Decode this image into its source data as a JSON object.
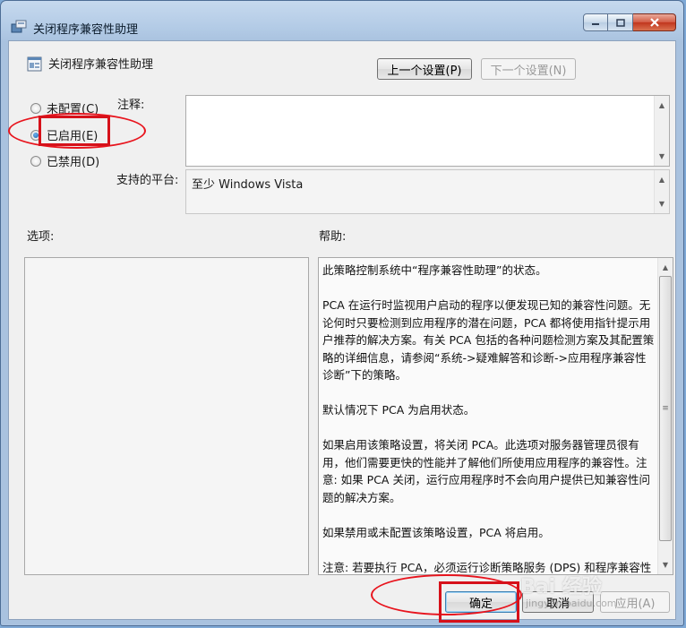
{
  "window": {
    "title": "关闭程序兼容性助理",
    "caption": {
      "minimize": "─",
      "maximize": "□",
      "close": "✕"
    }
  },
  "policy": {
    "name": "关闭程序兼容性助理",
    "prev_button": "上一个设置(P)",
    "next_button": "下一个设置(N)"
  },
  "state": {
    "options": [
      {
        "label": "未配置(C)",
        "checked": false
      },
      {
        "label": "已启用(E)",
        "checked": true
      },
      {
        "label": "已禁用(D)",
        "checked": false
      }
    ]
  },
  "comment": {
    "label": "注释:",
    "value": ""
  },
  "platform": {
    "label": "支持的平台:",
    "value": "至少 Windows Vista"
  },
  "options_section": {
    "label": "选项:"
  },
  "help_section": {
    "label": "帮助:",
    "paragraphs": [
      "此策略控制系统中“程序兼容性助理”的状态。",
      "PCA 在运行时监视用户启动的程序以便发现已知的兼容性问题。无论何时只要检测到应用程序的潜在问题，PCA 都将使用指针提示用户推荐的解决方案。有关 PCA 包括的各种问题检测方案及其配置策略的详细信息，请参阅“系统->疑难解答和诊断->应用程序兼容性诊断”下的策略。",
      "默认情况下 PCA 为启用状态。",
      "如果启用该策略设置，将关闭 PCA。此选项对服务器管理员很有用，他们需要更快的性能并了解他们所使用应用程序的兼容性。注意: 如果 PCA 关闭，运行应用程序时不会向用户提供已知兼容性问题的解决方案。",
      "如果禁用或未配置该策略设置，PCA 将启用。",
      "注意: 若要执行 PCA，必须运行诊断策略服务 (DPS) 和程序兼容性助手服务。可以使用 Microsoft 管理控制台的服务管理单元配置"
    ]
  },
  "footer": {
    "ok": "确定",
    "cancel": "取消",
    "apply": "应用(A)"
  },
  "watermark": {
    "text": "Bai 经验",
    "sub": "jingyan.baidu.com"
  },
  "colors": {
    "highlight": "#e8141d",
    "accent": "#1a5fa8"
  }
}
